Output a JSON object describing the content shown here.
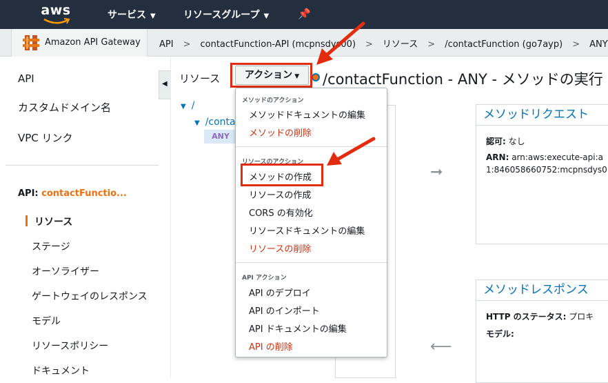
{
  "topnav": {
    "logo_text": "aws",
    "services": "サービス",
    "resource_groups": "リソースグループ"
  },
  "breadcrumb": {
    "service": "Amazon API Gateway",
    "items": [
      "API",
      "contactFunction-API (mcpnsdys00)",
      "リソース",
      "/contactFunction (go7ayp)",
      "ANY"
    ],
    "separator": ">"
  },
  "sidebar": {
    "top_links": [
      "API",
      "カスタムドメイン名",
      "VPC リンク"
    ],
    "api_prefix": "API: ",
    "api_name": "contactFunctio...",
    "active": "リソース",
    "sub_links": [
      "ステージ",
      "オーソライザー",
      "ゲートウェイのレスポンス",
      "モデル",
      "リソースポリシー",
      "ドキュメント"
    ]
  },
  "resources": {
    "title": "リソース",
    "root": "/",
    "child": "/contac",
    "method": "ANY"
  },
  "action_button": {
    "label": "アクション"
  },
  "page_title": "/contactFunction - ANY - メソッドの実行",
  "menu": {
    "method_actions_header": "メソッドのアクション",
    "method_actions": [
      {
        "label": "メソッドドキュメントの編集",
        "danger": false
      },
      {
        "label": "メソッドの削除",
        "danger": true
      }
    ],
    "resource_actions_header": "リソースのアクション",
    "resource_actions": [
      {
        "label": "メソッドの作成",
        "danger": false
      },
      {
        "label": "リソースの作成",
        "danger": false
      },
      {
        "label": "CORS の有効化",
        "danger": false
      },
      {
        "label": "リソースドキュメントの編集",
        "danger": false
      },
      {
        "label": "リソースの削除",
        "danger": true
      }
    ],
    "api_actions_header": "API アクション",
    "api_actions": [
      {
        "label": "API のデプロイ",
        "danger": false
      },
      {
        "label": "API のインポート",
        "danger": false
      },
      {
        "label": "API ドキュメントの編集",
        "danger": false
      },
      {
        "label": "API の削除",
        "danger": true
      }
    ]
  },
  "method_request": {
    "title": "メソッドリクエスト",
    "auth_label": "認可:",
    "auth_value": "なし",
    "arn_label": "ARN:",
    "arn_line1": "arn:aws:execute-api:a",
    "arn_line2": "1:846058660752:mcpnsdys0"
  },
  "method_response": {
    "title": "メソッドレスポンス",
    "status_label": "HTTP のステータス:",
    "status_value": "プロキ",
    "model_label": "モデル:"
  },
  "colors": {
    "nav_bg": "#232f3e",
    "accent_orange": "#ec7211",
    "link_blue": "#0073bb",
    "danger_red": "#d13212",
    "annotation_red": "#e32b0f"
  }
}
